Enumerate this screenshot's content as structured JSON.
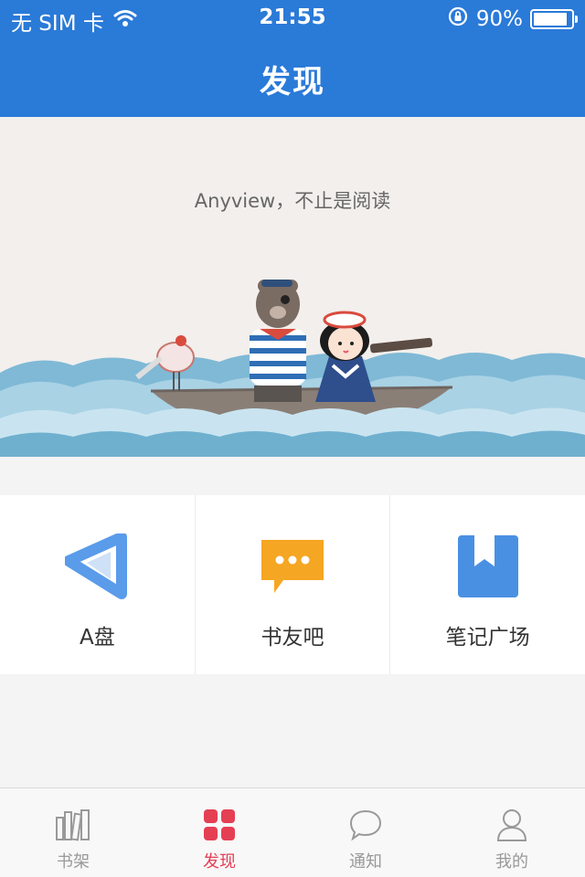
{
  "status_bar": {
    "carrier": "无 SIM 卡",
    "time": "21:55",
    "battery_text": "90%",
    "battery_level": 0.9
  },
  "nav": {
    "title": "发现"
  },
  "banner": {
    "slogan": "Anyview，不止是阅读"
  },
  "features": [
    {
      "label": "A盘",
      "icon": "a-disk-icon",
      "color": "#5a9bea"
    },
    {
      "label": "书友吧",
      "icon": "chat-bubble-icon",
      "color": "#f5a623"
    },
    {
      "label": "笔记广场",
      "icon": "bookmark-icon",
      "color": "#4a90e2"
    }
  ],
  "tabbar": {
    "tabs": [
      {
        "label": "书架",
        "icon": "bookshelf-icon",
        "active": false
      },
      {
        "label": "发现",
        "icon": "grid-icon",
        "active": true
      },
      {
        "label": "通知",
        "icon": "speech-bubble-icon",
        "active": false
      },
      {
        "label": "我的",
        "icon": "user-icon",
        "active": false
      }
    ]
  },
  "colors": {
    "primary": "#2a7ad8",
    "accent": "#e53f54"
  }
}
